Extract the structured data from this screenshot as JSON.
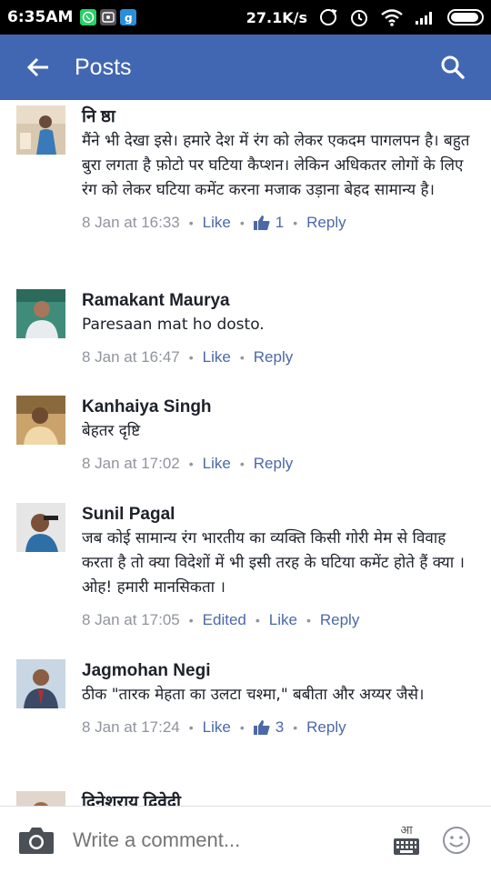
{
  "status_bar": {
    "time": "6:35AM",
    "speed": "27.1K/s",
    "left_icons": [
      "whatsapp-icon",
      "gallery-icon",
      "google-plus-icon"
    ],
    "right_icons": [
      "sync-icon",
      "alarm-icon",
      "wifi-icon",
      "signal-icon",
      "battery-icon"
    ]
  },
  "app_bar": {
    "title": "Posts",
    "accent": "#4267b2"
  },
  "comments": [
    {
      "author": "नि ष्ठा",
      "text": "मैंने भी देखा इसे। हमारे देश में रंग को लेकर एकदम पागलपन है। बहुत बुरा लगता है फ़ोटो पर घटिया कैप्शन। लेकिन अधिकतर लोगों के लिए रंग को लेकर घटिया कमेंट करना मजाक उड़ाना बेहद सामान्य है।",
      "time": "8 Jan at 16:33",
      "like": "Like",
      "like_count": "1",
      "reply": "Reply"
    },
    {
      "author": "Ramakant Maurya",
      "text": "Paresaan mat ho dosto.",
      "time": "8 Jan at 16:47",
      "like": "Like",
      "reply": "Reply"
    },
    {
      "author": "Kanhaiya Singh",
      "text": "बेहतर दृष्टि",
      "time": "8 Jan at 17:02",
      "like": "Like",
      "reply": "Reply"
    },
    {
      "author": "Sunil Pagal",
      "text": "जब कोई सामान्य रंग भारतीय का व्यक्ति किसी गोरी मेम से विवाह करता है तो क्या विदेशों में भी इसी तरह के घटिया कमेंट होते हैं क्या । ओह! हमारी मानसिकता ।",
      "time": "8 Jan at 17:05",
      "edited": "Edited",
      "like": "Like",
      "reply": "Reply"
    },
    {
      "author": "Jagmohan Negi",
      "text": "ठीक \"तारक मेहता का उलटा चश्मा,\" बबीता और अय्यर जैसे।",
      "time": "8 Jan at 17:24",
      "like": "Like",
      "like_count": "3",
      "reply": "Reply"
    },
    {
      "author": "दिनेशराय द्विवेदी"
    }
  ],
  "composer": {
    "placeholder": "Write a comment...",
    "keyboard_label": "आ"
  },
  "colors": {
    "link": "#4b69a6",
    "meta": "#90949c",
    "text": "#1d2129"
  }
}
